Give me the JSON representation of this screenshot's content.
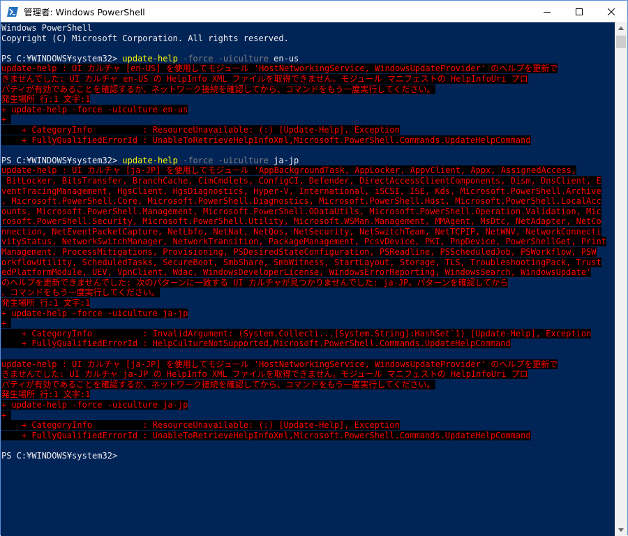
{
  "window": {
    "title": "管理者: Windows PowerShell",
    "icon": "powershell-icon",
    "controls": [
      "minimize-icon",
      "maximize-icon",
      "close-icon"
    ]
  },
  "colors": {
    "console_bg": "#012456",
    "error_fg": "#ff0000",
    "error_bg": "#000000",
    "command": "#ffff00",
    "parameter": "#808080",
    "text": "#eeedf0"
  },
  "console": {
    "lines": [
      {
        "kind": "text",
        "text": "Windows PowerShell"
      },
      {
        "kind": "text",
        "text": "Copyright (C) Microsoft Corporation. All rights reserved."
      },
      {
        "kind": "text",
        "text": ""
      },
      {
        "kind": "prompt",
        "prompt": "PS C:¥WINDOWS¥system32> ",
        "command": "update-help",
        "rest": [
          {
            "t": " -force",
            "c": "param"
          },
          {
            "t": " -uiculture",
            "c": "param"
          },
          {
            "t": " en-us",
            "c": "arg"
          }
        ]
      },
      {
        "kind": "error",
        "text": "update-help : UI カルチャ [en-US] を使用してモジュール 'HostNetworkingService, WindowsUpdateProvider' のヘルプを更新で"
      },
      {
        "kind": "error",
        "text": "きませんでした: UI カルチャ en-US の HelpInfo XML ファイルを取得できません。モジュール マニフェストの HelpInfoUri プロ"
      },
      {
        "kind": "error",
        "text": "パティが有効であることを確認するか、ネットワーク接続を確認してから、コマンドをもう一度実行してください。"
      },
      {
        "kind": "error",
        "text": "発生場所 行:1 文字:1"
      },
      {
        "kind": "error",
        "text": "+ update-help -force -uiculture en-us"
      },
      {
        "kind": "error",
        "text": "+ "
      },
      {
        "kind": "error",
        "text": "    + CategoryInfo          : ResourceUnavailable: (:) [Update-Help], Exception"
      },
      {
        "kind": "error",
        "text": "    + FullyQualifiedErrorId : UnableToRetrieveHelpInfoXml,Microsoft.PowerShell.Commands.UpdateHelpCommand"
      },
      {
        "kind": "text",
        "text": ""
      },
      {
        "kind": "prompt",
        "prompt": "PS C:¥WINDOWS¥system32> ",
        "command": "update-help",
        "rest": [
          {
            "t": " -force",
            "c": "param"
          },
          {
            "t": " -uiculture",
            "c": "param"
          },
          {
            "t": " ja-jp",
            "c": "arg"
          }
        ]
      },
      {
        "kind": "error",
        "text": "update-help : UI カルチャ [ja-JP] を使用してモジュール 'AppBackgroundTask, AppLocker, AppvClient, Appx, AssignedAccess,"
      },
      {
        "kind": "error",
        "text": " BitLocker, BitsTransfer, BranchCache, CimCmdlets, ConfigCI, Defender, DirectAccessClientComponents, Dism, DnsClient, E"
      },
      {
        "kind": "error",
        "text": "ventTracingManagement, HgsClient, HgsDiagnostics, Hyper-V, International, iSCSI, ISE, Kds, Microsoft.PowerShell.Archive"
      },
      {
        "kind": "error",
        "text": ", Microsoft.PowerShell.Core, Microsoft.PowerShell.Diagnostics, Microsoft.PowerShell.Host, Microsoft.PowerShell.LocalAcc"
      },
      {
        "kind": "error",
        "text": "ounts, Microsoft.PowerShell.Management, Microsoft.PowerShell.ODataUtils, Microsoft.PowerShell.Operation.Validation, Mic"
      },
      {
        "kind": "error",
        "text": "rosoft.PowerShell.Security, Microsoft.PowerShell.Utility, Microsoft.WSMan.Management, MMAgent, MsDtc, NetAdapter, NetCo"
      },
      {
        "kind": "error",
        "text": "nnection, NetEventPacketCapture, NetLbfo, NetNat, NetQos, NetSecurity, NetSwitchTeam, NetTCPIP, NetWNV, NetworkConnecti"
      },
      {
        "kind": "error",
        "text": "vityStatus, NetworkSwitchManager, NetworkTransition, PackageManagement, PcsvDevice, PKI, PnpDevice, PowerShellGet, Print"
      },
      {
        "kind": "error",
        "text": "Management, ProcessMitigations, Provisioning, PSDesiredStateConfiguration, PSReadline, PSScheduledJob, PSWorkflow, PSW"
      },
      {
        "kind": "error",
        "text": "orkflowUtility, ScheduledTasks, SecureBoot, SmbShare, SmbWitness, StartLayout, Storage, TLS, TroubleshootingPack, Trust"
      },
      {
        "kind": "error",
        "text": "edPlatformModule, UEV, VpnClient, Wdac, WindowsDeveloperLicense, WindowsErrorReporting, WindowsSearch, WindowsUpdate'"
      },
      {
        "kind": "error",
        "text": "のヘルプを更新できませんでした: 次のパターンに一致する UI カルチャが見つかりませんでした: ja-JP。パターンを確認してから"
      },
      {
        "kind": "error",
        "text": "、コマンドをもう一度実行してください。"
      },
      {
        "kind": "error",
        "text": "発生場所 行:1 文字:1"
      },
      {
        "kind": "error",
        "text": "+ update-help -force -uiculture ja-jp"
      },
      {
        "kind": "error",
        "text": "+ "
      },
      {
        "kind": "error",
        "text": "    + CategoryInfo          : InvalidArgument: (System.Collecti...[System.String]:HashSet`1) [Update-Help], Exception"
      },
      {
        "kind": "error",
        "text": "    + FullyQualifiedErrorId : HelpCultureNotSupported,Microsoft.PowerShell.Commands.UpdateHelpCommand"
      },
      {
        "kind": "text",
        "text": ""
      },
      {
        "kind": "error",
        "text": "update-help : UI カルチャ [ja-JP] を使用してモジュール 'HostNetworkingService, WindowsUpdateProvider' のヘルプを更新で"
      },
      {
        "kind": "error",
        "text": "きませんでした: UI カルチャ ja-JP の HelpInfo XML ファイルを取得できません。モジュール マニフェストの HelpInfoUri プロ"
      },
      {
        "kind": "error",
        "text": "パティが有効であることを確認するか、ネットワーク接続を確認してから、コマンドをもう一度実行してください。"
      },
      {
        "kind": "error",
        "text": "発生場所 行:1 文字:1"
      },
      {
        "kind": "error",
        "text": "+ update-help -force -uiculture ja-jp"
      },
      {
        "kind": "error",
        "text": "+ "
      },
      {
        "kind": "error",
        "text": "    + CategoryInfo          : ResourceUnavailable: (:) [Update-Help], Exception"
      },
      {
        "kind": "error",
        "text": "    + FullyQualifiedErrorId : UnableToRetrieveHelpInfoXml,Microsoft.PowerShell.Commands.UpdateHelpCommand"
      },
      {
        "kind": "text",
        "text": ""
      },
      {
        "kind": "prompt",
        "prompt": "PS C:¥WINDOWS¥system32>",
        "command": "",
        "rest": []
      }
    ]
  },
  "scrollbar": {
    "up_icon": "scroll-up-arrow-icon",
    "down_icon": "scroll-down-arrow-icon"
  }
}
